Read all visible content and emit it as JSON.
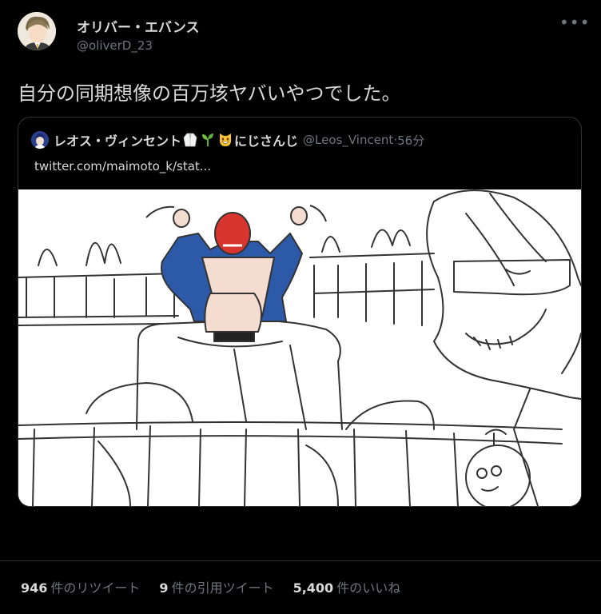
{
  "tweet": {
    "author": {
      "display_name": "オリバー・エバンス",
      "handle": "@oliverD_23"
    },
    "text": "自分の同期想像の百万垓ヤバいやつでした。",
    "more_icon": "ellipsis-icon"
  },
  "quote": {
    "display_name": "レオス・ヴィンセント",
    "name_suffix": "にじさんじ",
    "emoji": [
      "lab-coat-emoji",
      "seedling-emoji",
      "grinning-cat-emoji"
    ],
    "handle": "@Leos_Vincent",
    "separator": " · ",
    "time": "56分",
    "link_text": "twitter.com/maimoto_k/stat..."
  },
  "stats": [
    {
      "count": "946",
      "label": "件のリツイート"
    },
    {
      "count": "9",
      "label": "件の引用ツイート"
    },
    {
      "count": "5,400",
      "label": "件のいいね"
    }
  ]
}
